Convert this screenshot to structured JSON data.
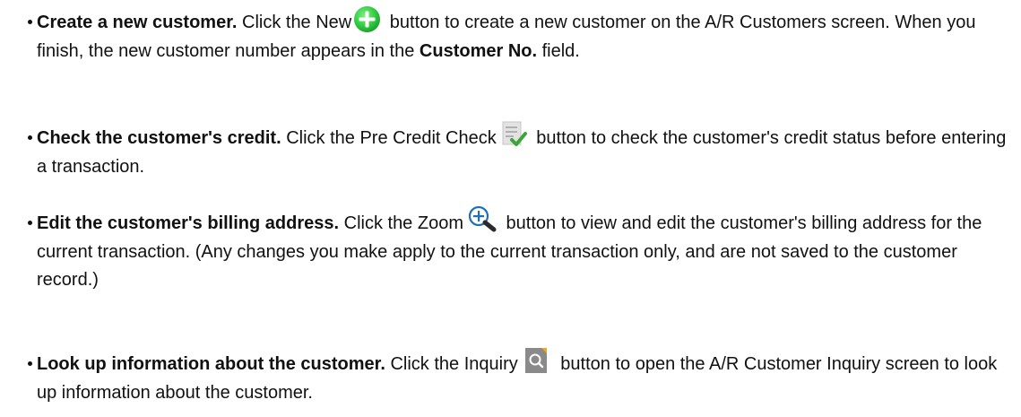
{
  "items": [
    {
      "lead": "Create a new customer.",
      "pre": " Click the New",
      "icon": "new-plus-icon",
      "post": " button to create a new customer on the A/R Customers screen. When you finish, the new customer number appears in the ",
      "strong": "Customer No.",
      "tail": " field."
    },
    {
      "lead": "Check the customer's credit.",
      "pre": " Click the Pre Credit Check",
      "icon": "credit-check-icon",
      "post": " button to check the customer's credit status before entering a transaction."
    },
    {
      "lead": "Edit the customer's billing address.",
      "pre": " Click the Zoom",
      "icon": "zoom-icon",
      "post": " button to view and edit the customer's billing address for the current transaction. (Any changes you make apply to the current transaction only, and are not saved to the customer record.)"
    },
    {
      "lead": "Look up information about the customer.",
      "pre": " Click the Inquiry",
      "icon": "inquiry-icon",
      "post": " button to open the A/R Customer Inquiry screen to look up information about the customer."
    }
  ],
  "colors": {
    "new_icon_green": "#2ecc40",
    "credit_check_green": "#3aa63a",
    "zoom_blue": "#1f6fb8",
    "inquiry_gray": "#8a8a8a",
    "inquiry_accent": "#f2a51a"
  }
}
